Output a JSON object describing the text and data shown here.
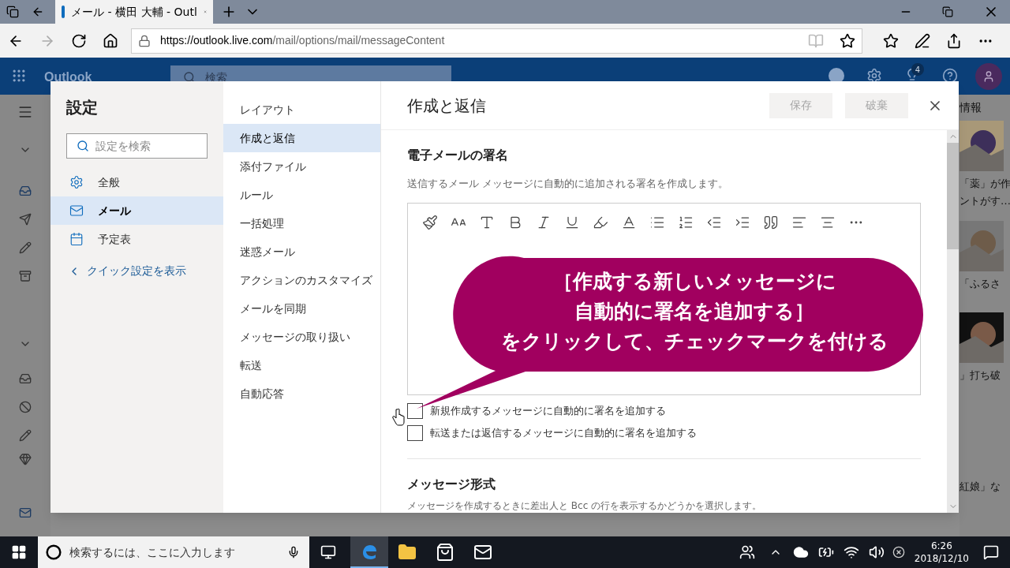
{
  "browser": {
    "tab_title": "メール - 横田 大輔 - Outl",
    "url_host": "https://outlook.live.com",
    "url_path": "/mail/options/mail/messageContent"
  },
  "outlook_header": {
    "app_name": "Outlook",
    "search_placeholder": "検索",
    "notification_count": "4"
  },
  "settings": {
    "title": "設定",
    "search_placeholder": "設定を検索",
    "categories": [
      {
        "label": "全般",
        "kind": "gear",
        "selected": false
      },
      {
        "label": "メール",
        "kind": "mail",
        "selected": true
      },
      {
        "label": "予定表",
        "kind": "calendar",
        "selected": false
      }
    ],
    "quick_settings_link": "クイック設定を表示",
    "subcategories": [
      {
        "label": "レイアウト",
        "selected": false
      },
      {
        "label": "作成と返信",
        "selected": true
      },
      {
        "label": "添付ファイル",
        "selected": false
      },
      {
        "label": "ルール",
        "selected": false
      },
      {
        "label": "一括処理",
        "selected": false
      },
      {
        "label": "迷惑メール",
        "selected": false
      },
      {
        "label": "アクションのカスタマイズ",
        "selected": false
      },
      {
        "label": "メールを同期",
        "selected": false
      },
      {
        "label": "メッセージの取り扱い",
        "selected": false
      },
      {
        "label": "転送",
        "selected": false
      },
      {
        "label": "自動応答",
        "selected": false
      }
    ]
  },
  "pane": {
    "title": "作成と返信",
    "buttons": [
      {
        "label": "保存",
        "disabled": true
      },
      {
        "label": "破棄",
        "disabled": true
      }
    ],
    "signature": {
      "heading": "電子メールの署名",
      "description": "送信するメール メッセージに自動的に追加される署名を作成します。",
      "checkboxes": [
        {
          "label": "新規作成するメッセージに自動的に署名を追加する",
          "checked": false
        },
        {
          "label": "転送または返信するメッセージに自動的に署名を追加する",
          "checked": false
        }
      ]
    },
    "message_format": {
      "heading": "メッセージ形式",
      "description": "メッセージを作成するときに差出人と Bcc の行を表示するかどうかを選択します。"
    }
  },
  "callout": {
    "lines": [
      "［作成する新しいメッセージに",
      "自動的に署名を追加する］",
      "をクリックして、チェックマークを付ける"
    ]
  },
  "news": {
    "heading": "情報",
    "snippets": [
      "「薬」が作",
      "ントがす…",
      "「ふるさ",
      "」打ち破",
      "紅娘」な"
    ]
  },
  "taskbar": {
    "search_placeholder": "検索するには、ここに入力します",
    "time": "6:26",
    "date": "2018/12/10",
    "apps": [
      {
        "kind": "edge",
        "selected": true
      },
      {
        "kind": "explorer",
        "selected": false
      },
      {
        "kind": "store",
        "selected": false
      },
      {
        "kind": "mail",
        "selected": false
      }
    ]
  }
}
